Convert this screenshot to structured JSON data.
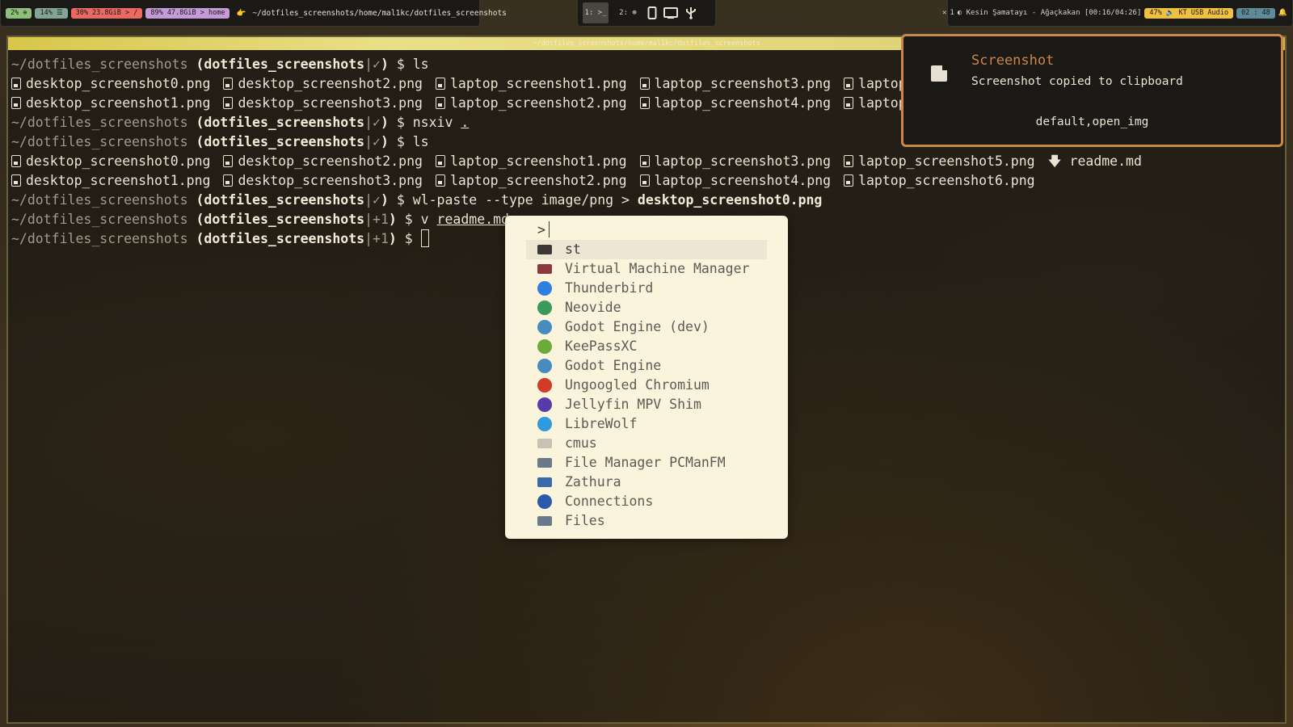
{
  "topbar": {
    "left": {
      "cpu": "2% ⊕",
      "mem": "14% ☰",
      "disk_root": "30% 23.8GiB > /",
      "disk_home": "89% 47.8GiB > home",
      "cwd_icon": "👉",
      "cwd": "~/dotfiles_screenshots/home/mal1kc/dotfiles_screenshots"
    },
    "middle": {
      "ws1": "1: ≻_",
      "ws2": "2: ⊛",
      "icons": [
        "tablet-icon",
        "monitor-icon",
        "usb-icon"
      ]
    },
    "right": {
      "close": "✕",
      "player_index": "1",
      "now_playing": "◐ Kesin Şamatayı - Ağaçkakan [00:16/04:26]",
      "volume": "47% 🔈 KT USB Audio",
      "clock": "02 : 48",
      "bell": "🔔"
    }
  },
  "terminal": {
    "title": "~/dotfiles_screenshots/home/mal1kc/dotfiles_screenshots",
    "prompt_path": "~/dotfiles_screenshots",
    "branch": "dotfiles_screenshots",
    "clean": "✓",
    "dirty": "+1",
    "cmd_ls": "ls",
    "cmd_nsxiv": "nsxiv",
    "nsxiv_arg": ".",
    "cmd_wlpaste": "wl-paste --type image/png >",
    "wlpaste_target": "desktop_screenshot0.png",
    "cmd_v": "v",
    "v_arg": "readme.md",
    "ls1": {
      "row1": [
        "desktop_screenshot0.png",
        "desktop_screenshot2.png",
        "laptop_screenshot1.png",
        "laptop_screenshot3.png",
        "laptop_screensh"
      ],
      "row2": [
        "desktop_screenshot1.png",
        "desktop_screenshot3.png",
        "laptop_screenshot2.png",
        "laptop_screenshot4.png",
        "laptop_screensh"
      ]
    },
    "ls2": {
      "row1": [
        "desktop_screenshot0.png",
        "desktop_screenshot2.png",
        "laptop_screenshot1.png",
        "laptop_screenshot3.png",
        "laptop_screenshot5.png"
      ],
      "row1_md": "readme.md",
      "row2": [
        "desktop_screenshot1.png",
        "desktop_screenshot3.png",
        "laptop_screenshot2.png",
        "laptop_screenshot4.png",
        "laptop_screenshot6.png"
      ]
    }
  },
  "launcher": {
    "prompt": ">",
    "items": [
      {
        "label": "st",
        "icon": "terminal-icon",
        "color": "#3c3836"
      },
      {
        "label": "Virtual Machine Manager",
        "icon": "vmm-icon",
        "color": "#8a3a3a"
      },
      {
        "label": "Thunderbird",
        "icon": "thunderbird-icon",
        "color": "#2f7fe0"
      },
      {
        "label": "Neovide",
        "icon": "neovide-icon",
        "color": "#3a9a5a"
      },
      {
        "label": "Godot Engine (dev)",
        "icon": "godot-icon",
        "color": "#478cbf"
      },
      {
        "label": "KeePassXC",
        "icon": "keepassxc-icon",
        "color": "#6aab3c"
      },
      {
        "label": "Godot Engine",
        "icon": "godot-icon",
        "color": "#478cbf"
      },
      {
        "label": "Ungoogled Chromium",
        "icon": "chromium-icon",
        "color": "#d23a2a"
      },
      {
        "label": "Jellyfin MPV Shim",
        "icon": "jellyfin-icon",
        "color": "#5a3aa8"
      },
      {
        "label": "LibreWolf",
        "icon": "librewolf-icon",
        "color": "#2f9ae0"
      },
      {
        "label": "cmus",
        "icon": "cmus-icon",
        "color": "#c8c2b2"
      },
      {
        "label": "File Manager PCManFM",
        "icon": "pcmanfm-icon",
        "color": "#6a7a8a"
      },
      {
        "label": "Zathura",
        "icon": "zathura-icon",
        "color": "#3a6aa8"
      },
      {
        "label": "Connections",
        "icon": "connections-icon",
        "color": "#2a5aa8"
      },
      {
        "label": "Files",
        "icon": "files-icon",
        "color": "#6a7a8a"
      }
    ]
  },
  "notification": {
    "summary": "Screenshot",
    "body": "Screenshot copied to clipboard",
    "actions": "default,open_img"
  }
}
